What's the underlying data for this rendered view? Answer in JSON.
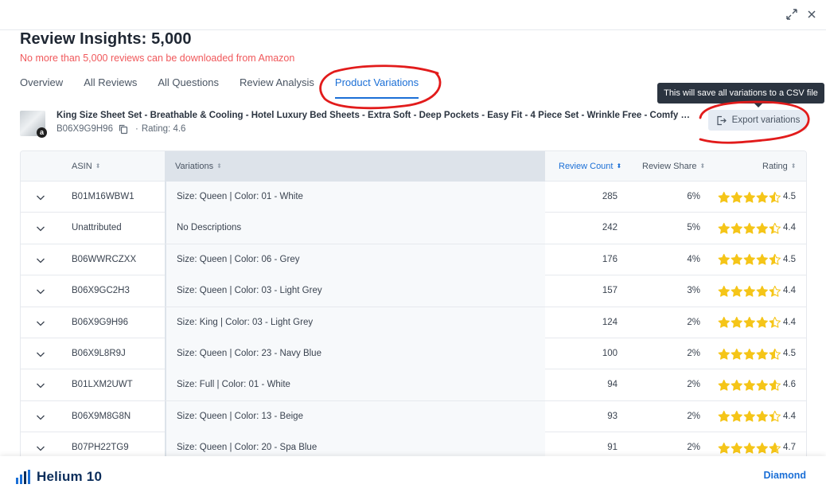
{
  "window": {
    "expand_icon": "expand-icon",
    "close_icon": "close-icon"
  },
  "header": {
    "title": "Review Insights: 5,000",
    "warning": "No more than 5,000 reviews can be downloaded from Amazon"
  },
  "tabs": [
    {
      "label": "Overview",
      "active": false
    },
    {
      "label": "All Reviews",
      "active": false
    },
    {
      "label": "All Questions",
      "active": false
    },
    {
      "label": "Review Analysis",
      "active": false
    },
    {
      "label": "Product Variations",
      "active": true
    }
  ],
  "product": {
    "title": "King Size Sheet Set - Breathable & Cooling - Hotel Luxury Bed Sheets - Extra Soft - Deep Pockets - Easy Fit - 4 Piece Set - Wrinkle Free - Comfy – Light…",
    "asin": "B06X9G9H96",
    "separator": "·",
    "rating": "Rating: 4.6",
    "marketplace_badge": "a"
  },
  "export": {
    "label": "Export variations",
    "tooltip": "This will save all variations to a CSV file",
    "icon": "export-icon"
  },
  "table": {
    "columns": {
      "asin": "ASIN",
      "variations": "Variations",
      "review_count": "Review Count",
      "review_share": "Review Share",
      "rating": "Rating"
    },
    "sorted_by": "review_count",
    "sort_direction": "desc",
    "rows": [
      {
        "asin": "B01M16WBW1",
        "variation": "Size: Queen | Color: 01 - White",
        "count": "285",
        "share": "6%",
        "rating": "4.5",
        "rating_value": 4.5
      },
      {
        "asin": "Unattributed",
        "variation": "No Descriptions",
        "count": "242",
        "share": "5%",
        "rating": "4.4",
        "rating_value": 4.4
      },
      {
        "asin": "B06WWRCZXX",
        "variation": "Size: Queen | Color: 06 - Grey",
        "count": "176",
        "share": "4%",
        "rating": "4.5",
        "rating_value": 4.5
      },
      {
        "asin": "B06X9GC2H3",
        "variation": "Size: Queen | Color: 03 - Light Grey",
        "count": "157",
        "share": "3%",
        "rating": "4.4",
        "rating_value": 4.4
      },
      {
        "asin": "B06X9G9H96",
        "variation": "Size: King | Color: 03 - Light Grey",
        "count": "124",
        "share": "2%",
        "rating": "4.4",
        "rating_value": 4.4
      },
      {
        "asin": "B06X9L8R9J",
        "variation": "Size: Queen | Color: 23 - Navy Blue",
        "count": "100",
        "share": "2%",
        "rating": "4.5",
        "rating_value": 4.5
      },
      {
        "asin": "B01LXM2UWT",
        "variation": "Size: Full | Color: 01 - White",
        "count": "94",
        "share": "2%",
        "rating": "4.6",
        "rating_value": 4.6
      },
      {
        "asin": "B06X9M8G8N",
        "variation": "Size: Queen | Color: 13 - Beige",
        "count": "93",
        "share": "2%",
        "rating": "4.4",
        "rating_value": 4.4
      },
      {
        "asin": "B07PH22TG9",
        "variation": "Size: Queen | Color: 20 - Spa Blue",
        "count": "91",
        "share": "2%",
        "rating": "4.7",
        "rating_value": 4.7
      }
    ]
  },
  "footer": {
    "brand": "Helium 10",
    "plan": "Diamond"
  },
  "colors": {
    "accent": "#1b6fd6",
    "warning": "#f0585b",
    "star": "#f5c518",
    "annotation": "#e21b1b",
    "brand_navy": "#0b2d5b"
  }
}
